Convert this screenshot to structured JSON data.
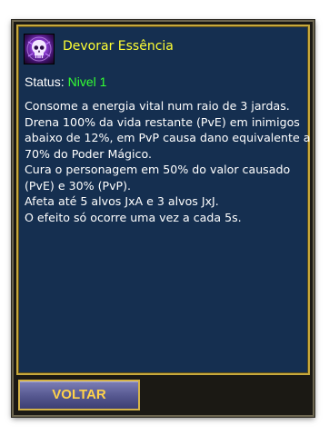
{
  "skill": {
    "icon": "skull-icon",
    "name": "Devorar Essência"
  },
  "status": {
    "label": "Status:",
    "value": "Nivel 1"
  },
  "description_lines": [
    "Consome a energia vital num raio de 3 jardas.",
    "Drena 100% da vida restante (PvE) em inimigos",
    "abaixo de 12%, em PvP causa dano equivalente a",
    "70% do Poder Mágico.",
    "Cura o personagem em 50% do valor causado",
    "(PvE) e 30% (PvP).",
    "Afeta até 5 alvos JxA e 3 alvos JxJ.",
    "O efeito só ocorre uma vez a cada 5s."
  ],
  "buttons": {
    "back_label": "VOLTAR"
  },
  "colors": {
    "skill_name": "#ffff33",
    "status_value": "#33ff33",
    "panel_bg": "#152f50",
    "panel_border": "#c8a93c"
  }
}
